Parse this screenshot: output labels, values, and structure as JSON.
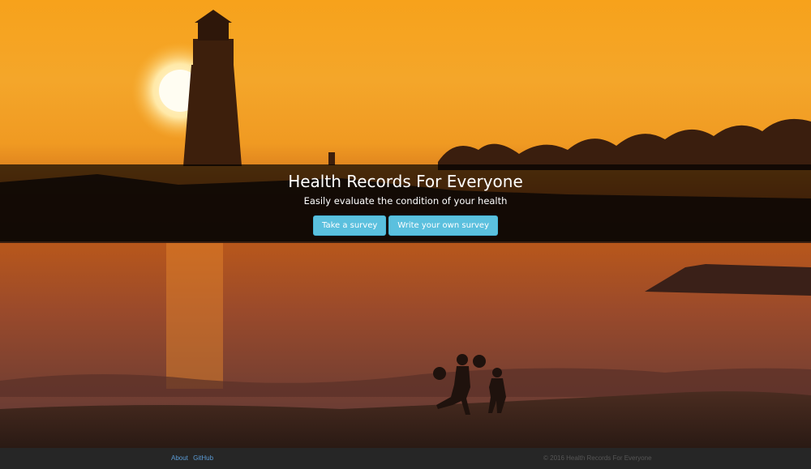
{
  "hero": {
    "title": "Health Records For Everyone",
    "subtitle": "Easily evaluate the condition of your health",
    "buttons": {
      "take_survey": "Take a survey",
      "write_survey": "Write your own survey"
    }
  },
  "footer": {
    "links": {
      "about": "About",
      "github": "GitHub"
    },
    "copyright": "© 2016 Health Records For Everyone"
  },
  "colors": {
    "button": "#5bc0de",
    "banner_overlay": "rgba(0,0,0,0.68)",
    "footer_bg": "#262626",
    "link": "#5b9bd5"
  }
}
